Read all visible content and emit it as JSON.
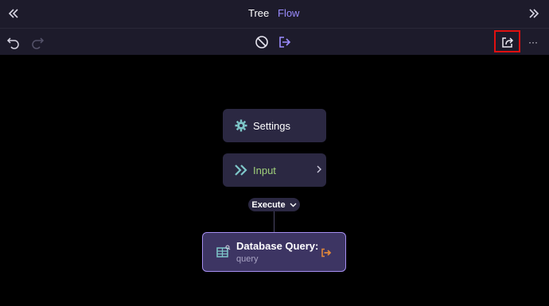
{
  "topbar": {
    "collapse_left_icon": "chevrons-left-icon",
    "tabs": [
      {
        "label": "Tree"
      },
      {
        "label": "Flow"
      }
    ],
    "collapse_right_icon": "chevrons-right-icon"
  },
  "toolbar": {
    "undo_icon": "undo-icon",
    "redo_icon": "redo-icon",
    "clear_icon": "ban-icon",
    "run_icon": "arrow-right-box-icon",
    "export_icon": "share-icon",
    "more_label": "···"
  },
  "flow": {
    "settings_node": {
      "label": "Settings"
    },
    "input_node": {
      "label": "Input"
    },
    "execute_badge": {
      "label": "Execute"
    },
    "db_node": {
      "title": "Database Query:",
      "subtitle": "query"
    }
  },
  "colors": {
    "background": "#000000",
    "bar": "#1d1b2b",
    "node": "#2b2842",
    "accent": "#9b8cff",
    "input_green": "#9fd07a",
    "icon_teal": "#7ec7c9",
    "db_border": "#a58ef0",
    "exit_orange": "#e0873a",
    "highlight_red": "#e01010"
  }
}
